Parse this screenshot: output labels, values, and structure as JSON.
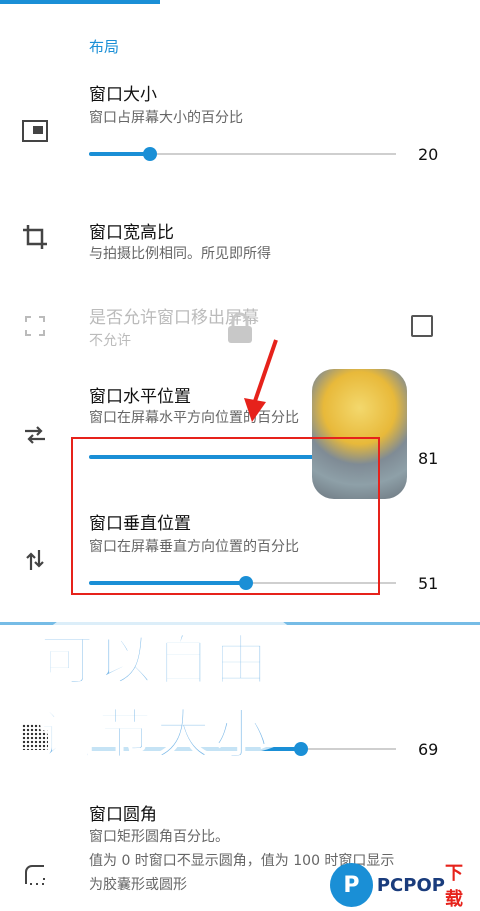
{
  "section": {
    "title": "布局"
  },
  "rows": {
    "size": {
      "title": "窗口大小",
      "subtitle": "窗口占屏幕大小的百分比",
      "value": "20",
      "level": 0.2
    },
    "ratio": {
      "title": "窗口宽高比",
      "subtitle": "与拍摄比例相同。所见即所得"
    },
    "offscreen": {
      "title": "是否允许窗口移出屏幕",
      "subtitle": "不允许"
    },
    "hpos": {
      "title": "窗口水平位置",
      "subtitle": "窗口在屏幕水平方向位置的百分比",
      "value": "81",
      "level": 0.81
    },
    "vpos": {
      "title": "窗口垂直位置",
      "subtitle": "窗口在屏幕垂直方向位置的百分比",
      "value": "51",
      "level": 0.51
    },
    "hidden": {
      "value": "69",
      "level": 0.69
    },
    "corner": {
      "title": "窗口圆角",
      "subtitle": "窗口矩形圆角百分比。",
      "desc1": "值为 0 时窗口不显示圆角，值为 100 时窗口显示",
      "desc2": "为胶囊形或圆形"
    }
  },
  "overlay": {
    "line1": "可以自由",
    "line2": "调节大小"
  },
  "watermark": {
    "logo_letter": "P",
    "name": "PCPOP",
    "suffix": "下载"
  },
  "colors": {
    "accent": "#1a8fd6",
    "highlight": "#e6221b"
  },
  "icons": [
    "picture-in-picture-icon",
    "crop-icon",
    "fullscreen-icon",
    "lock-icon",
    "swap-horizontal-icon",
    "swap-vertical-icon",
    "rounded-corner-icon"
  ]
}
